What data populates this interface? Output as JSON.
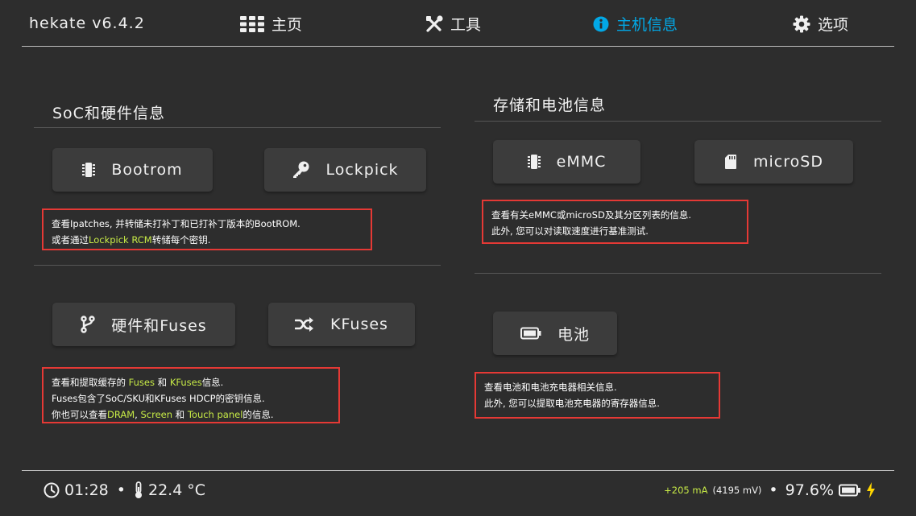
{
  "header": {
    "title": "hekate v6.4.2",
    "tabs": [
      {
        "label": "主页",
        "icon": "grid-icon"
      },
      {
        "label": "工具",
        "icon": "tools-icon"
      },
      {
        "label": "主机信息",
        "icon": "info-icon",
        "active": true
      },
      {
        "label": "选项",
        "icon": "gear-icon"
      }
    ]
  },
  "left": {
    "title": "SoC和硬件信息",
    "bootrom_label": "Bootrom",
    "lockpick_label": "Lockpick",
    "desc1": {
      "l1": "查看Ipatches, 并转储未打补丁和已打补丁版本的BootROM.",
      "l2a": "或者通过",
      "l2b": "Lockpick RCM",
      "l2c": "转储每个密钥."
    },
    "hw_label": "硬件和Fuses",
    "kfuses_label": "KFuses",
    "desc2": {
      "l1a": "查看和提取缓存的 ",
      "l1b": "Fuses",
      "l1c": " 和 ",
      "l1d": "KFuses",
      "l1e": "信息.",
      "l2": "Fuses包含了SoC/SKU和KFuses HDCP的密钥信息.",
      "l3a": "你也可以查看",
      "l3b": "DRAM",
      "l3c": ", ",
      "l3d": "Screen",
      "l3e": " 和 ",
      "l3f": "Touch panel",
      "l3g": "的信息."
    }
  },
  "right": {
    "title": "存储和电池信息",
    "emmc_label": "eMMC",
    "microsd_label": "microSD",
    "desc1": {
      "l1": "查看有关eMMC或microSD及其分区列表的信息.",
      "l2": "此外, 您可以对读取速度进行基准测试."
    },
    "battery_label": "电池",
    "desc2": {
      "l1": "查看电池和电池充电器相关信息.",
      "l2": "此外, 您可以提取电池充电器的寄存器信息."
    }
  },
  "status": {
    "time": "01:28",
    "sep": "•",
    "temp": "22.4",
    "temp_unit": "°C",
    "current": "+205 mA",
    "voltage": "(4195 mV)",
    "battery_pct": "97.6%",
    "colors": {
      "accent": "#02a8e6",
      "highlight": "#c7ea46",
      "border": "#e53935"
    }
  }
}
